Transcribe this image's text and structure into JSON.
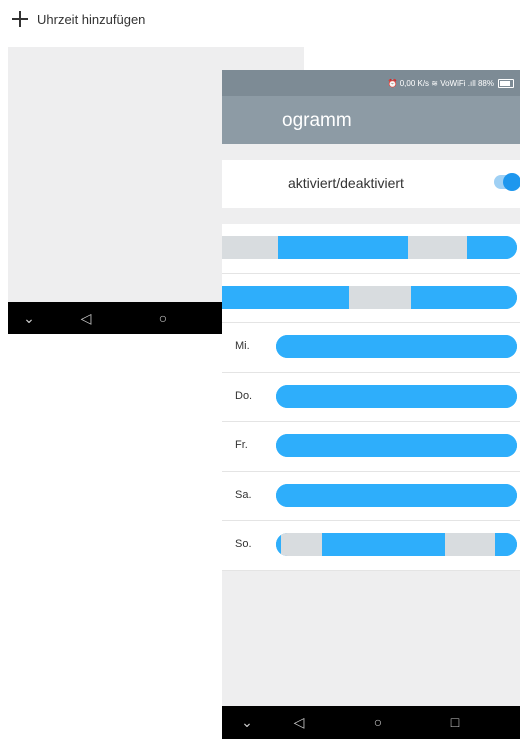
{
  "add_time": {
    "label": "Uhrzeit hinzufügen"
  },
  "status_bar": {
    "text": "⏰ 0,00 K/s ≋ VoWiFi .ıll 88%"
  },
  "app_bar": {
    "title": "ogramm"
  },
  "toggle_row": {
    "label": "aktiviert/deaktiviert",
    "enabled": true
  },
  "days": [
    {
      "label": "",
      "segments": [
        {
          "start": 0.0,
          "end": 0.19,
          "type": "off"
        },
        {
          "start": 0.19,
          "end": 0.63,
          "type": "on"
        },
        {
          "start": 0.63,
          "end": 0.83,
          "type": "off"
        },
        {
          "start": 0.83,
          "end": 1.0,
          "type": "on"
        }
      ]
    },
    {
      "label": "",
      "segments": [
        {
          "start": 0.0,
          "end": 0.43,
          "type": "on"
        },
        {
          "start": 0.43,
          "end": 0.64,
          "type": "off"
        },
        {
          "start": 0.64,
          "end": 1.0,
          "type": "on"
        }
      ]
    },
    {
      "label": "Mi.",
      "segments": [
        {
          "start": 0.0,
          "end": 1.0,
          "type": "on"
        }
      ]
    },
    {
      "label": "Do.",
      "segments": [
        {
          "start": 0.0,
          "end": 1.0,
          "type": "on"
        }
      ]
    },
    {
      "label": "Fr.",
      "segments": [
        {
          "start": 0.0,
          "end": 1.0,
          "type": "on"
        }
      ]
    },
    {
      "label": "Sa.",
      "segments": [
        {
          "start": 0.0,
          "end": 1.0,
          "type": "on"
        }
      ]
    },
    {
      "label": "So.",
      "segments": [
        {
          "start": 0.0,
          "end": 0.02,
          "type": "on"
        },
        {
          "start": 0.02,
          "end": 0.19,
          "type": "off"
        },
        {
          "start": 0.19,
          "end": 0.7,
          "type": "on"
        },
        {
          "start": 0.7,
          "end": 0.91,
          "type": "off"
        },
        {
          "start": 0.91,
          "end": 1.0,
          "type": "on"
        }
      ]
    }
  ],
  "colors": {
    "on": "#2eaefb",
    "off": "#d8dcdf",
    "appbar": "#8d9ba5",
    "statusbar": "#7d8b95",
    "toggle": "#1e97ee"
  },
  "nav_icons": [
    "chevron-down-icon",
    "back-icon",
    "home-icon",
    "recents-icon"
  ]
}
